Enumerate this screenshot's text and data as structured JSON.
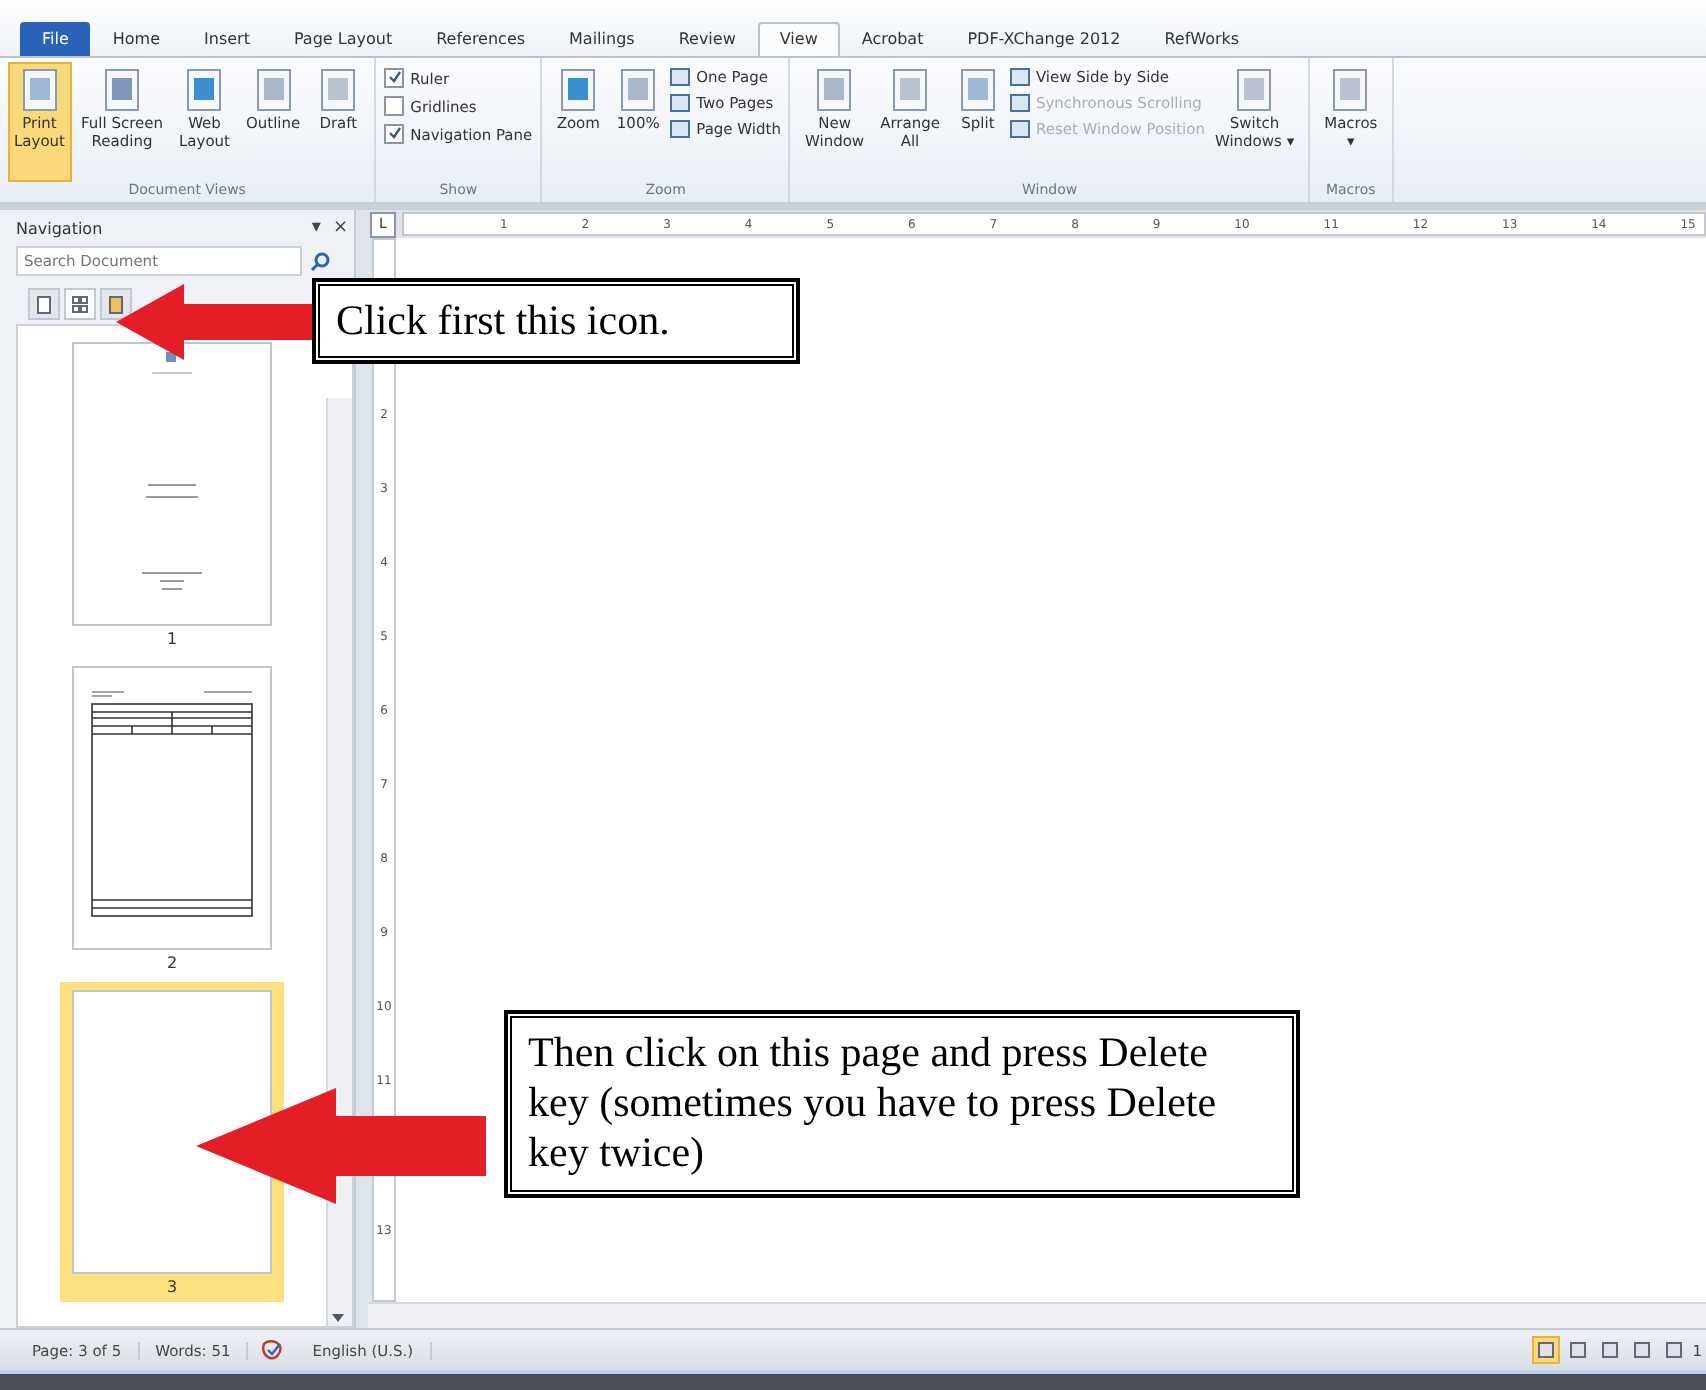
{
  "tabs": [
    {
      "label": "File",
      "kind": "file",
      "selected": false
    },
    {
      "label": "Home",
      "kind": "tab",
      "selected": false
    },
    {
      "label": "Insert",
      "kind": "tab",
      "selected": false
    },
    {
      "label": "Page Layout",
      "kind": "tab",
      "selected": false
    },
    {
      "label": "References",
      "kind": "tab",
      "selected": false
    },
    {
      "label": "Mailings",
      "kind": "tab",
      "selected": false
    },
    {
      "label": "Review",
      "kind": "tab",
      "selected": false
    },
    {
      "label": "View",
      "kind": "tab",
      "selected": true
    },
    {
      "label": "Acrobat",
      "kind": "tab",
      "selected": false
    },
    {
      "label": "PDF-XChange 2012",
      "kind": "tab",
      "selected": false
    },
    {
      "label": "RefWorks",
      "kind": "tab",
      "selected": false
    }
  ],
  "ribbon_groups": [
    {
      "label": "Document Views",
      "items": [
        {
          "kind": "large",
          "label": "Print\nLayout",
          "selected": true
        },
        {
          "kind": "large",
          "label": "Full Screen\nReading",
          "selected": false
        },
        {
          "kind": "large",
          "label": "Web\nLayout",
          "selected": false
        },
        {
          "kind": "large",
          "label": "Outline",
          "selected": false
        },
        {
          "kind": "large",
          "label": "Draft",
          "selected": false
        }
      ]
    },
    {
      "label": "Show",
      "items": [
        {
          "kind": "check",
          "label": "Ruler",
          "checked": true
        },
        {
          "kind": "check",
          "label": "Gridlines",
          "checked": false
        },
        {
          "kind": "check",
          "label": "Navigation Pane",
          "checked": true
        }
      ]
    },
    {
      "label": "Zoom",
      "items": [
        {
          "kind": "large",
          "label": "Zoom",
          "selected": false
        },
        {
          "kind": "large",
          "label": "100%",
          "selected": false
        },
        {
          "kind": "small",
          "label": "One Page",
          "disabled": false
        },
        {
          "kind": "small",
          "label": "Two Pages",
          "disabled": false
        },
        {
          "kind": "small",
          "label": "Page Width",
          "disabled": false
        }
      ]
    },
    {
      "label": "Window",
      "items": [
        {
          "kind": "large",
          "label": "New\nWindow",
          "selected": false
        },
        {
          "kind": "large",
          "label": "Arrange\nAll",
          "selected": false
        },
        {
          "kind": "large",
          "label": "Split",
          "selected": false
        },
        {
          "kind": "small",
          "label": "View Side by Side",
          "disabled": false
        },
        {
          "kind": "small",
          "label": "Synchronous Scrolling",
          "disabled": true
        },
        {
          "kind": "small",
          "label": "Reset Window Position",
          "disabled": true
        },
        {
          "kind": "large",
          "label": "Switch\nWindows ▾",
          "selected": false
        }
      ]
    },
    {
      "label": "Macros",
      "items": [
        {
          "kind": "large",
          "label": "Macros\n▾",
          "selected": false
        }
      ]
    }
  ],
  "navigation": {
    "title": "Navigation",
    "menu": "▾",
    "close": "×",
    "search": {
      "placeholder": "Search Document"
    },
    "views": [
      {
        "selected": false
      },
      {
        "selected": true
      },
      {
        "selected": false
      }
    ],
    "pages": [
      {
        "number": "1",
        "kind": "title",
        "selected": false
      },
      {
        "number": "2",
        "kind": "table",
        "selected": false
      },
      {
        "number": "3",
        "kind": "blank",
        "selected": true
      }
    ]
  },
  "ruler": {
    "corner": "L",
    "numbers": [
      "1",
      "2",
      "3",
      "4",
      "5",
      "6",
      "7",
      "8",
      "9",
      "10",
      "11",
      "12",
      "13",
      "14",
      "15"
    ],
    "vertical_numbers_upper": [
      "2",
      "3",
      "4",
      "5",
      "6",
      "7",
      "8",
      "9",
      "10",
      "11"
    ],
    "vertical_numbers_lower": [
      "13"
    ]
  },
  "status_bar": {
    "page": "Page: 3 of 5",
    "words": "Words: 51",
    "language": "English (U.S.)",
    "views": [
      {
        "selected": true
      },
      {
        "selected": false
      },
      {
        "selected": false
      },
      {
        "selected": false
      },
      {
        "selected": false
      }
    ],
    "zoom": "1"
  },
  "callouts": [
    {
      "text": "Click first this icon."
    },
    {
      "text": "Then click on this page and press Delete key (sometimes you have to press Delete key twice)"
    }
  ]
}
